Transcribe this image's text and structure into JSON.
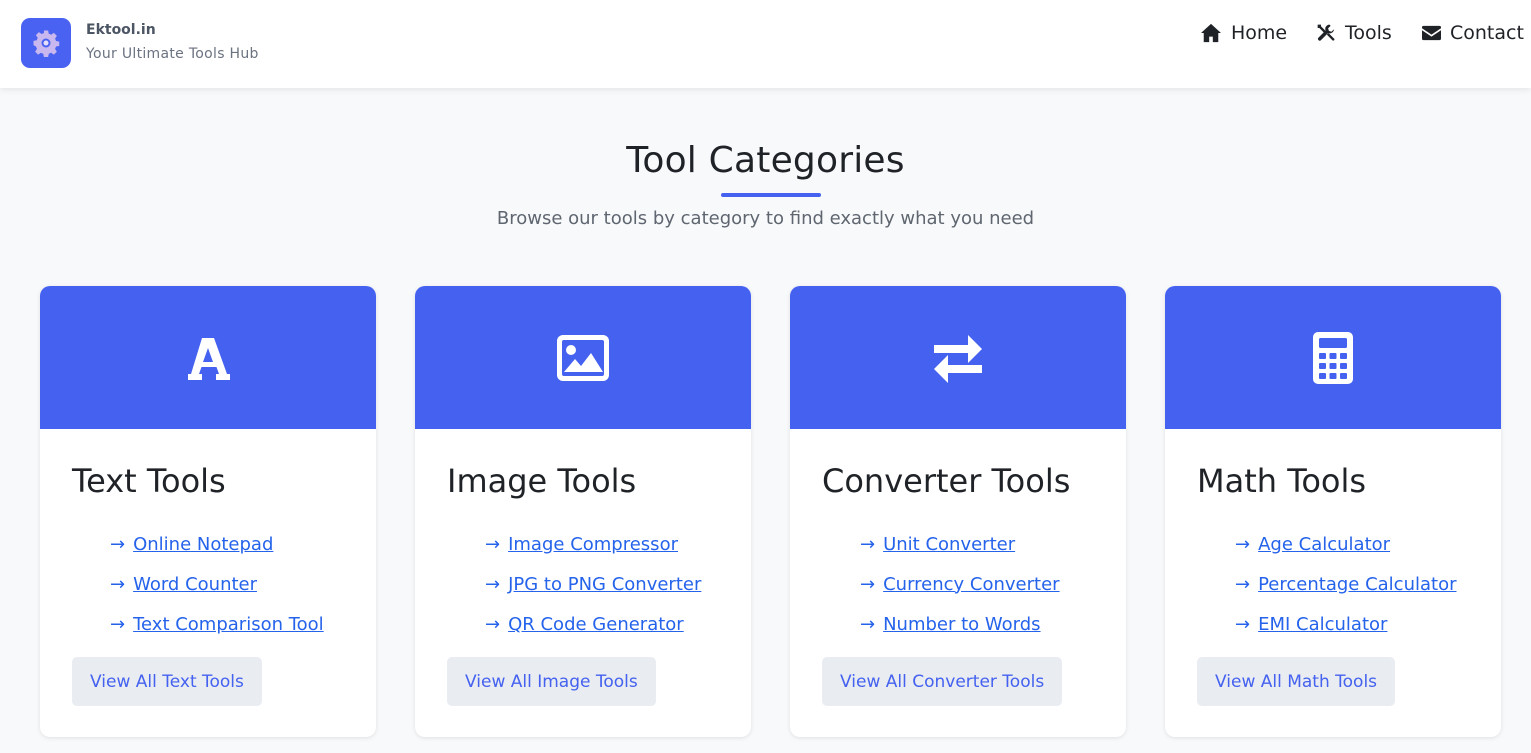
{
  "brand": {
    "name": "Ektool.in",
    "tagline": "Your Ultimate Tools Hub",
    "logo_icon": "gear-icon",
    "accent": "#4461f0"
  },
  "nav": {
    "items": [
      {
        "label": "Home",
        "icon": "home-icon"
      },
      {
        "label": "Tools",
        "icon": "tools-icon"
      },
      {
        "label": "Contact",
        "icon": "envelope-icon"
      }
    ]
  },
  "section": {
    "title": "Tool Categories",
    "subtitle": "Browse our tools by category to find exactly what you need"
  },
  "categories": [
    {
      "title": "Text Tools",
      "icon": "font-icon",
      "arrow": "→",
      "links": [
        "Online Notepad",
        "Word Counter",
        "Text Comparison Tool"
      ],
      "button": "View All Text Tools"
    },
    {
      "title": "Image Tools",
      "icon": "image-icon",
      "arrow": "→",
      "links": [
        "Image Compressor",
        "JPG to PNG Converter",
        "QR Code Generator"
      ],
      "button": "View All Image Tools"
    },
    {
      "title": "Converter Tools",
      "icon": "exchange-icon",
      "arrow": "→",
      "links": [
        "Unit Converter",
        "Currency Converter",
        "Number to Words"
      ],
      "button": "View All Converter Tools"
    },
    {
      "title": "Math Tools",
      "icon": "calculator-icon",
      "arrow": "→",
      "links": [
        "Age Calculator",
        "Percentage Calculator",
        "EMI Calculator"
      ],
      "button": "View All Math Tools"
    }
  ]
}
